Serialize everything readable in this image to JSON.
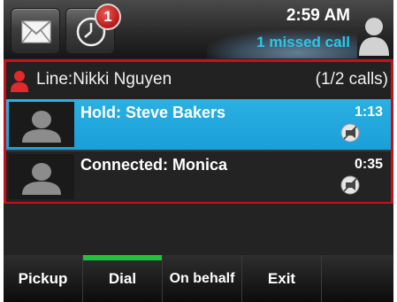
{
  "status_bar": {
    "messages_icon": "envelope-icon",
    "calls_icon": "clock-icon",
    "missed_badge_count": "1",
    "time": "2:59 AM",
    "missed_calls_text": "1 missed call",
    "user_icon": "person-icon"
  },
  "line": {
    "label": "Line:Nikki Nguyen",
    "call_count": "(1/2 calls)",
    "icon": "person-icon"
  },
  "calls": [
    {
      "title": "Hold: Steve Bakers",
      "duration": "1:13",
      "icon": "mute-icon",
      "state": "hold"
    },
    {
      "title": "Connected: Monica",
      "duration": "0:35",
      "icon": "mute-icon",
      "state": "connected"
    }
  ],
  "softkeys": [
    "Pickup",
    "Dial",
    "On behalf",
    "Exit",
    ""
  ],
  "colors": {
    "accent_blue": "#1a9fd8",
    "frame_red": "#c8101a",
    "badge_red": "#c11f1f",
    "missed_text": "#2cc7e8",
    "active_key_green": "#22c13c"
  }
}
